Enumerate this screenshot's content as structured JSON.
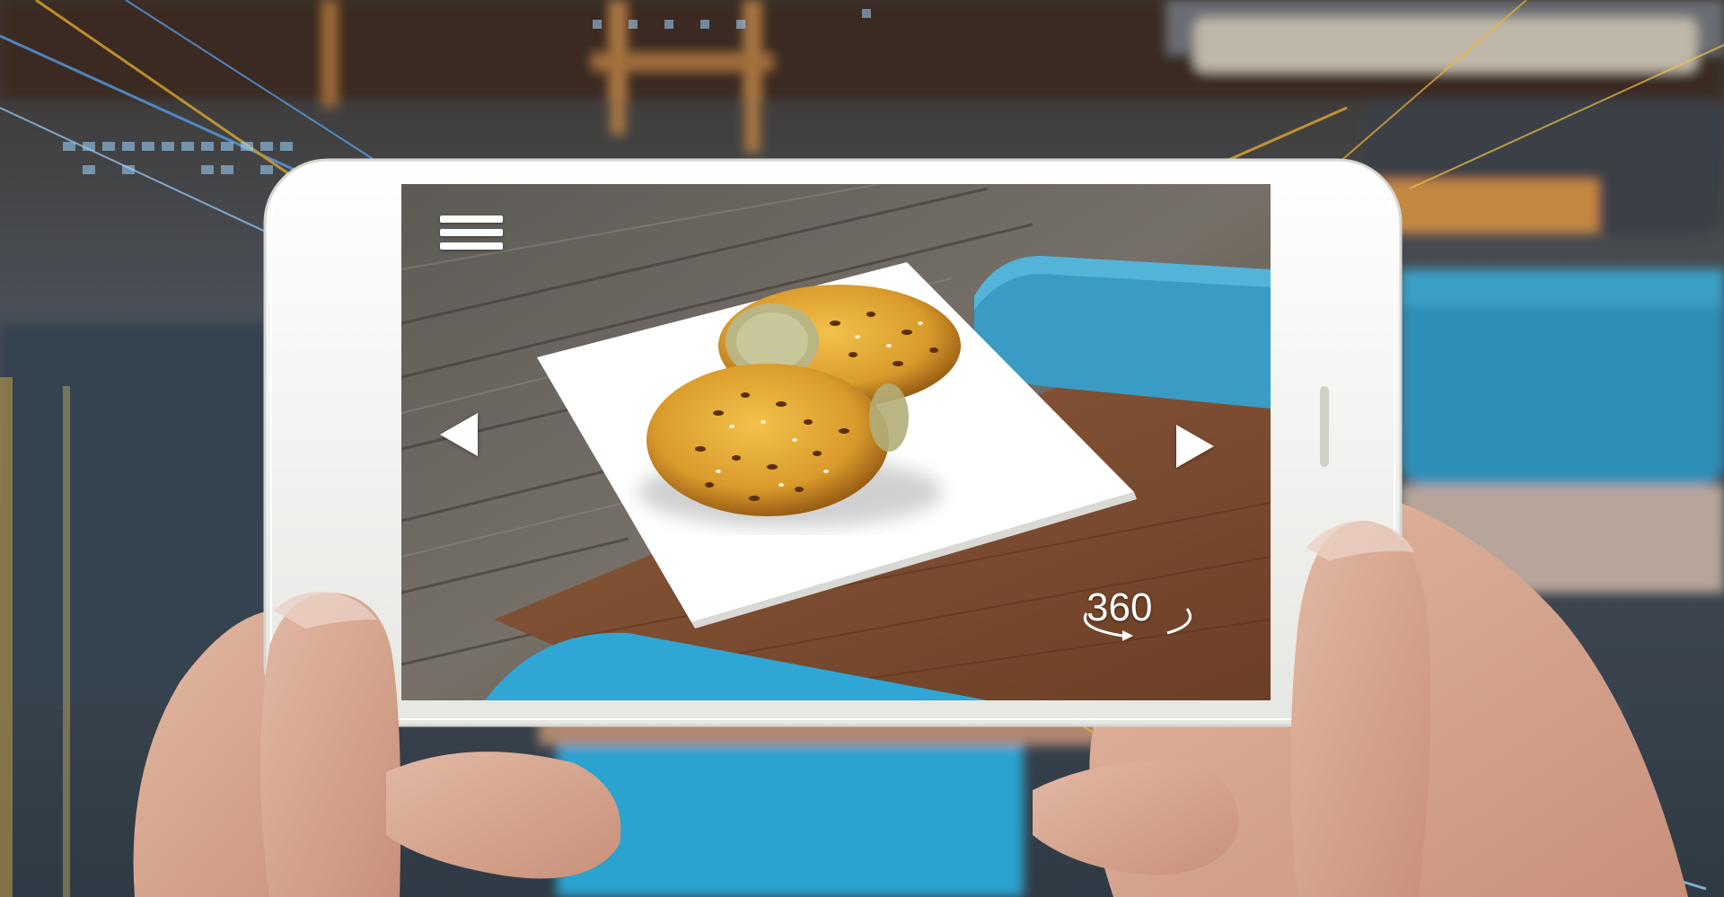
{
  "ar_view": {
    "menu_icon": "hamburger-menu-icon",
    "prev_icon": "triangle-left-icon",
    "next_icon": "triangle-right-icon",
    "rotate_label": "360",
    "rotate_icon": "rotate-360-icon"
  },
  "colors": {
    "accent_blue": "#3aa0c8",
    "glow_gold": "#f2b630",
    "phone_white": "#f4f4f2"
  }
}
